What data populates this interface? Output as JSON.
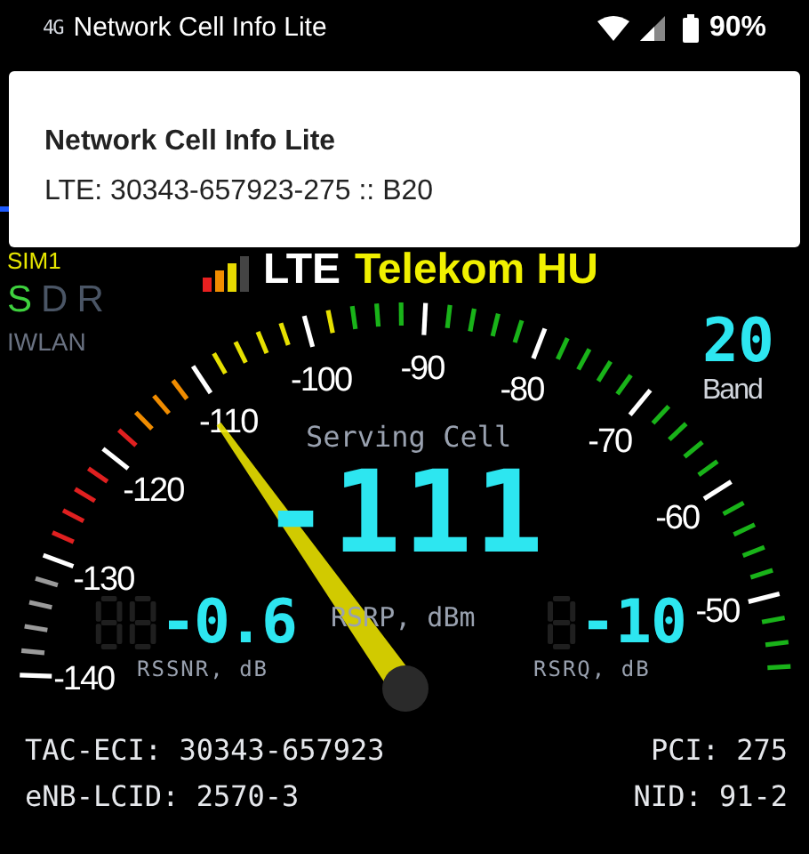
{
  "status_bar": {
    "network_type": "4G",
    "app_name": "Network Cell Info Lite",
    "battery": "90%"
  },
  "notification": {
    "title": "Network Cell Info Lite",
    "text": "LTE: 30343-657923-275 :: B20"
  },
  "header": {
    "sim": "SIM1",
    "technology": "LTE",
    "operator": "Telekom HU"
  },
  "modes": [
    {
      "label": "S",
      "active": true
    },
    {
      "label": "D",
      "active": false
    },
    {
      "label": "R",
      "active": false
    }
  ],
  "iwlan": "IWLAN",
  "band": {
    "value": "20",
    "label": "Band"
  },
  "gauge": {
    "title": "Serving Cell",
    "scale_labels": [
      "-140",
      "-130",
      "-120",
      "-110",
      "-100",
      "-90",
      "-80",
      "-70",
      "-60",
      "-50"
    ],
    "rsrp": {
      "value": "-111",
      "unit": "RSRP, dBm"
    },
    "rssnr": {
      "value": "-0.6",
      "unit": "RSSNR, dB"
    },
    "rsrq": {
      "value": "-10",
      "unit": "RSRQ, dB"
    }
  },
  "info_left": [
    "TAC-ECI: 30343-657923",
    "eNB-LCID: 2570-3"
  ],
  "info_right": [
    "PCI: 275",
    "NID: 91-2"
  ]
}
